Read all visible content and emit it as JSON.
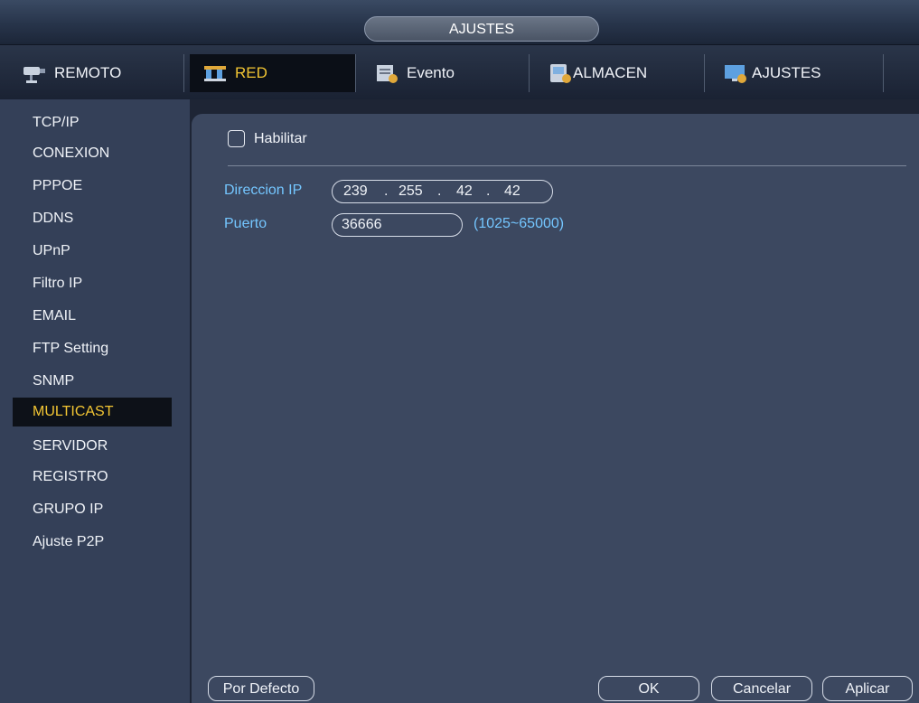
{
  "window": {
    "title": "AJUSTES"
  },
  "tabs": [
    {
      "label": "REMOTO",
      "icon": "camera-icon"
    },
    {
      "label": "RED",
      "icon": "network-icon"
    },
    {
      "label": "Evento",
      "icon": "event-icon"
    },
    {
      "label": "ALMACEN",
      "icon": "storage-icon"
    },
    {
      "label": "AJUSTES",
      "icon": "settings-monitor-icon"
    }
  ],
  "sidebar": {
    "items": [
      {
        "label": "TCP/IP"
      },
      {
        "label": "CONEXION"
      },
      {
        "label": "PPPOE"
      },
      {
        "label": "DDNS"
      },
      {
        "label": "UPnP"
      },
      {
        "label": "Filtro IP"
      },
      {
        "label": "EMAIL"
      },
      {
        "label": "FTP Setting"
      },
      {
        "label": "SNMP"
      },
      {
        "label": "MULTICAST"
      },
      {
        "label": "SERVIDOR"
      },
      {
        "label": "REGISTRO"
      },
      {
        "label": "GRUPO IP"
      },
      {
        "label": "Ajuste P2P"
      }
    ]
  },
  "form": {
    "enable_label": "Habilitar",
    "enabled": false,
    "ip_label": "Direccion IP",
    "ip": [
      "239",
      "255",
      "42",
      "42"
    ],
    "ip_separator": ".",
    "port_label": "Puerto",
    "port_value": "36666",
    "port_range": "(1025~65000)"
  },
  "buttons": {
    "default": "Por Defecto",
    "ok": "OK",
    "cancel": "Cancelar",
    "apply": "Aplicar"
  },
  "colors": {
    "accent": "#f2c533",
    "label_blue": "#74c6ff",
    "panel": "#3c4860",
    "sidebar": "#344058"
  }
}
